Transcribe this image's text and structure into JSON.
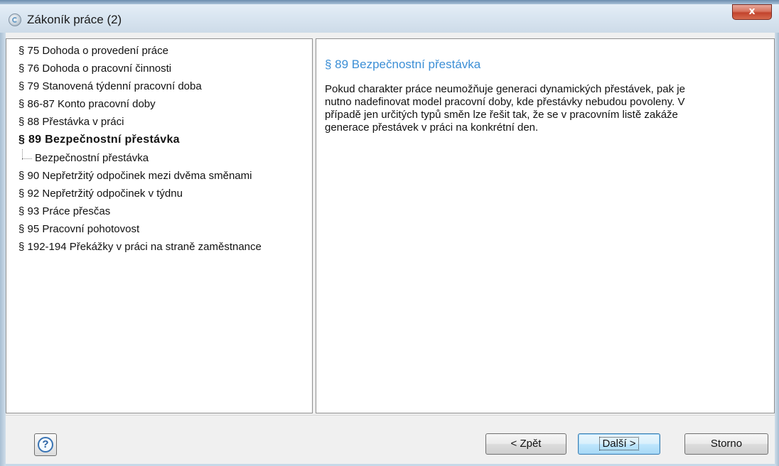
{
  "window": {
    "title": "Zákoník práce (2)",
    "close_glyph": "x",
    "app_icon": "app-disc-icon"
  },
  "tree": {
    "items": [
      {
        "label": "§ 75 Dohoda o provedení práce"
      },
      {
        "label": "§ 76 Dohoda o pracovní činnosti"
      },
      {
        "label": "§ 79 Stanovená týdenní pracovní doba"
      },
      {
        "label": "§ 86-87 Konto pracovní doby"
      },
      {
        "label": "§ 88 Přestávka v práci"
      },
      {
        "label": "§ 89 Bezpečnostní přestávka",
        "selected": true
      },
      {
        "label": "Bezpečnostní přestávka",
        "child": true
      },
      {
        "label": "§ 90 Nepřetržitý odpočinek mezi dvěma směnami"
      },
      {
        "label": "§ 92 Nepřetržitý odpočinek v týdnu"
      },
      {
        "label": "§ 93 Práce přesčas"
      },
      {
        "label": "§ 95 Pracovní pohotovost"
      },
      {
        "label": "§ 192-194 Překážky v práci na straně zaměstnance"
      }
    ]
  },
  "content": {
    "heading": "§ 89 Bezpečnostní přestávka",
    "lines": [
      "Pokud charakter práce neumožňuje generaci dynamických přestávek, pak je",
      "nutno nadefinovat model pracovní doby, kde přestávky nebudou povoleny. V",
      "případě jen určitých typů směn lze řešit tak, že se v pracovním listě zakáže",
      "generace přestávek v práci na konkrétní den."
    ],
    "heading_color": "#3c8fd6"
  },
  "buttons": {
    "help_glyph": "?",
    "back_label": "< Zpět",
    "next_label": "Další >",
    "cancel_label": "Storno"
  }
}
